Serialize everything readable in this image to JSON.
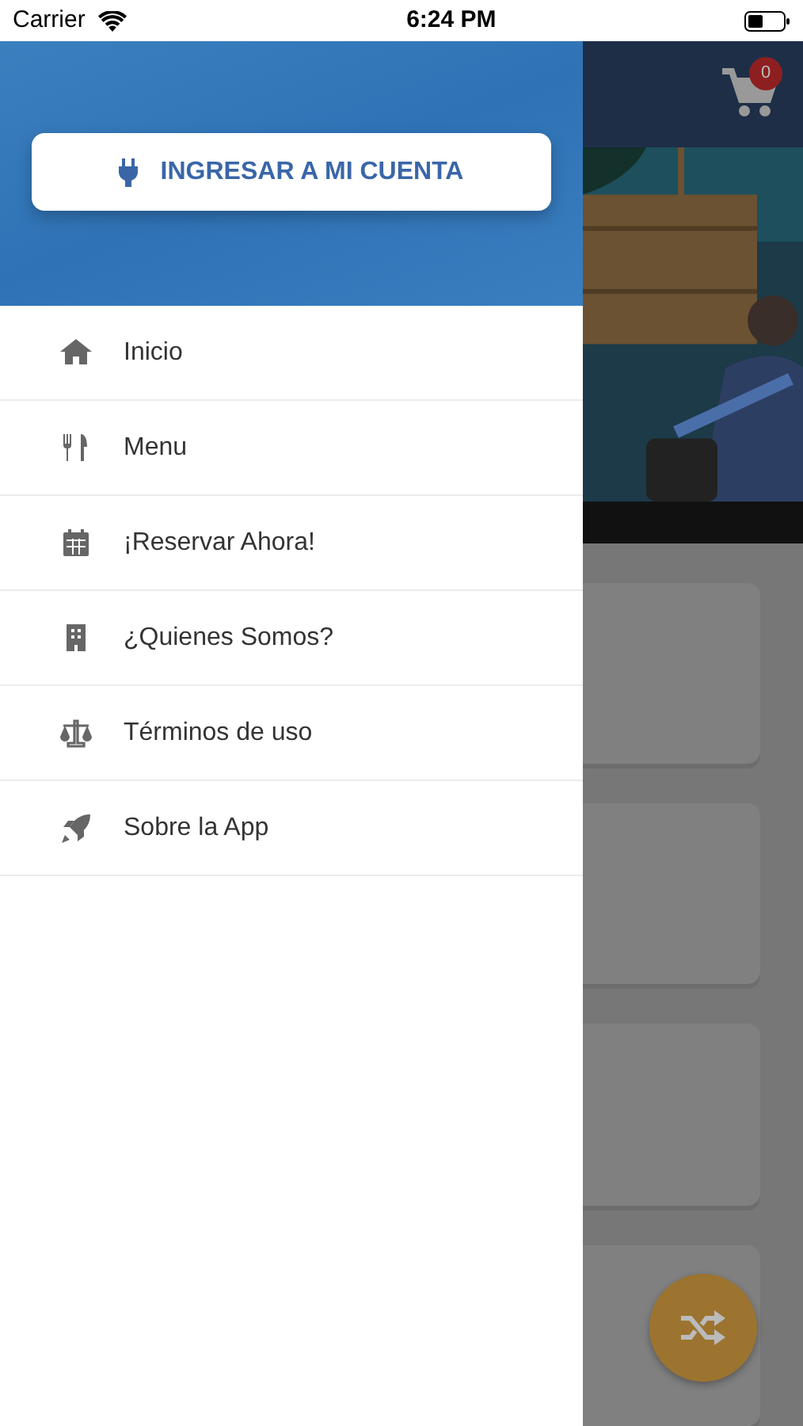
{
  "status_bar": {
    "carrier": "Carrier",
    "time": "6:24 PM"
  },
  "drawer": {
    "login_button": {
      "label": "INGRESAR A MI CUENTA"
    },
    "items": [
      {
        "label": "Inicio"
      },
      {
        "label": "Menu"
      },
      {
        "label": "¡Reservar Ahora!"
      },
      {
        "label": "¿Quienes Somos?"
      },
      {
        "label": "Términos de uso"
      },
      {
        "label": "Sobre la App"
      }
    ]
  },
  "background_screen": {
    "cart_badge": "0"
  }
}
